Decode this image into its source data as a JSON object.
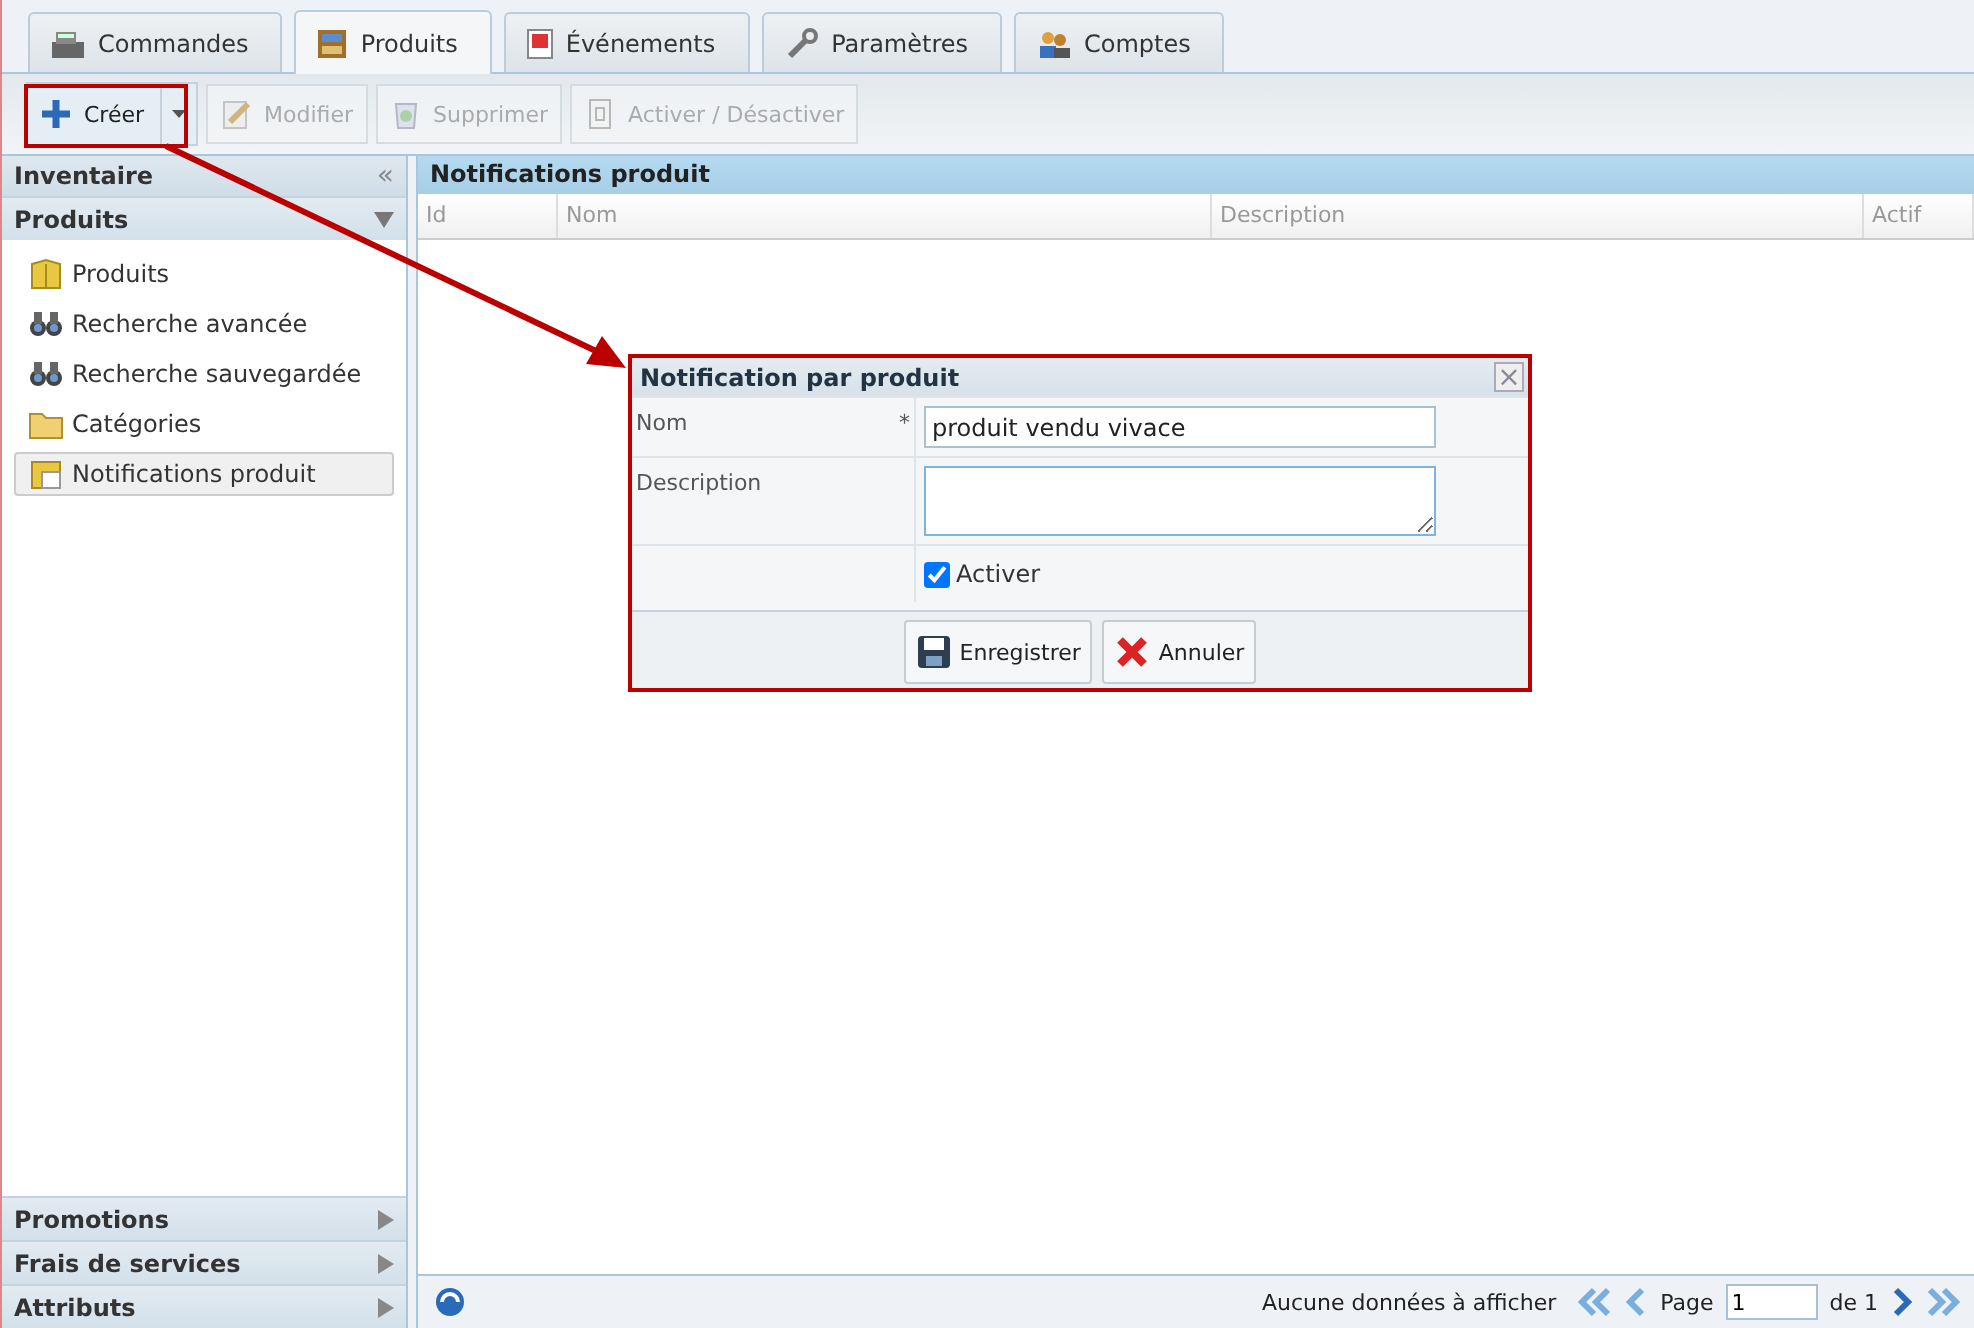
{
  "tabs": [
    {
      "label": "Commandes",
      "selected": false
    },
    {
      "label": "Produits",
      "selected": true
    },
    {
      "label": "Événements",
      "selected": false
    },
    {
      "label": "Paramètres",
      "selected": false
    },
    {
      "label": "Comptes",
      "selected": false
    }
  ],
  "toolbar": [
    {
      "label": "Créer",
      "disabled": false
    },
    {
      "label": "Modifier",
      "disabled": true
    },
    {
      "label": "Supprimer",
      "disabled": true
    },
    {
      "label": "Activer / Désactiver",
      "disabled": true
    }
  ],
  "sidebar": {
    "title": "Inventaire",
    "collapse": "«",
    "sections": [
      {
        "title": "Produits",
        "expanded": true,
        "items": [
          {
            "label": "Produits",
            "selected": false
          },
          {
            "label": "Recherche avancée",
            "selected": false
          },
          {
            "label": "Recherche sauvegardée",
            "selected": false
          },
          {
            "label": "Catégories",
            "selected": false
          },
          {
            "label": "Notifications produit",
            "selected": true
          }
        ]
      },
      {
        "title": "Promotions",
        "expanded": false
      },
      {
        "title": "Frais de services",
        "expanded": false
      },
      {
        "title": "Attributs",
        "expanded": false
      }
    ]
  },
  "grid": {
    "title": "Notifications produit",
    "columns": [
      "Id",
      "Nom",
      "Description",
      "Actif"
    ],
    "footer": {
      "message": "Aucune données à afficher",
      "page_label": "Page",
      "page": "1",
      "of_label": "de 1"
    }
  },
  "dialog": {
    "title": "Notification par produit",
    "close": "×",
    "name_label": "Nom",
    "required": "*",
    "name_value": "produit vendu vivace",
    "description_label": "Description",
    "active_label": "Activer",
    "active_checked": true,
    "buttons": [
      {
        "label": "Enregistrer"
      },
      {
        "label": "Annuler"
      }
    ]
  }
}
